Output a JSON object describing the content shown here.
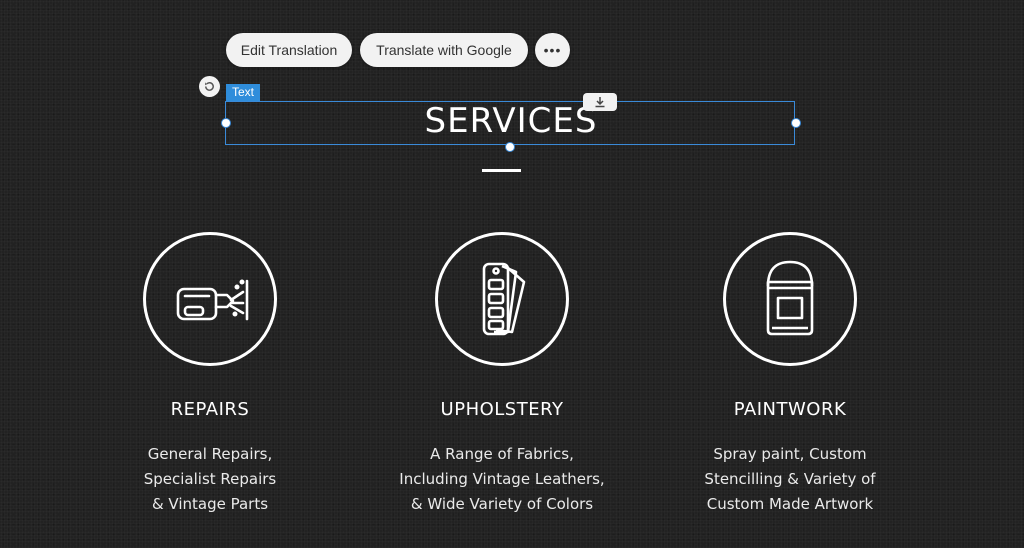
{
  "toolbar": {
    "edit_translation": "Edit Translation",
    "translate_google": "Translate with Google",
    "more": "•••"
  },
  "editor": {
    "element_tag": "Text",
    "undo_icon": "undo-icon",
    "download_icon": "download-icon",
    "accent_color": "#2f8ddb"
  },
  "section": {
    "title": "SERVICES"
  },
  "services": [
    {
      "icon": "repair-tool-icon",
      "title": "REPAIRS",
      "lines": [
        "General Repairs,",
        "Specialist Repairs",
        "& Vintage Parts"
      ]
    },
    {
      "icon": "fabric-swatch-icon",
      "title": "UPHOLSTERY",
      "lines": [
        "A Range of Fabrics,",
        "Including Vintage Leathers,",
        "& Wide Variety of Colors"
      ]
    },
    {
      "icon": "paint-bucket-icon",
      "title": "PAINTWORK",
      "lines": [
        "Spray paint, Custom",
        "Stencilling & Variety of",
        "Custom Made Artwork"
      ]
    }
  ]
}
